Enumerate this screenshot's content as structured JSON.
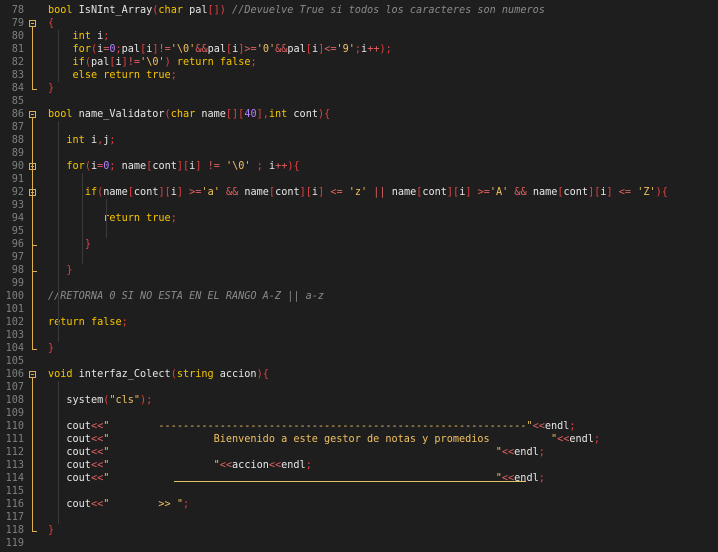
{
  "editor": {
    "accent_color": "#f6c400",
    "fold_color": "#e0b050",
    "lines": [
      {
        "n": "78",
        "tokens": [
          [
            "kw",
            "bool "
          ],
          [
            "fn",
            "IsNInt_Array"
          ],
          [
            "pn",
            "("
          ],
          [
            "ty",
            "char "
          ],
          [
            "id",
            "pal"
          ],
          [
            "pn",
            "[]"
          ],
          [
            "pn",
            ")"
          ],
          [
            "cm",
            " //Devuelve True si todos los caracteres son numeros"
          ]
        ]
      },
      {
        "n": "79",
        "tokens": [
          [
            "pn",
            "{"
          ]
        ]
      },
      {
        "n": "80",
        "tokens": [
          [
            "id",
            "    "
          ],
          [
            "kw",
            "int "
          ],
          [
            "id",
            "i"
          ],
          [
            "pn",
            ";"
          ]
        ]
      },
      {
        "n": "81",
        "tokens": [
          [
            "id",
            "    "
          ],
          [
            "kw",
            "for"
          ],
          [
            "pn",
            "("
          ],
          [
            "id",
            "i"
          ],
          [
            "op",
            "="
          ],
          [
            "num",
            "0"
          ],
          [
            "pn",
            ";"
          ],
          [
            "id",
            "pal"
          ],
          [
            "pn",
            "["
          ],
          [
            "id",
            "i"
          ],
          [
            "pn",
            "]"
          ],
          [
            "op",
            "!="
          ],
          [
            "str",
            "'\\0'"
          ],
          [
            "op",
            "&&"
          ],
          [
            "id",
            "pal"
          ],
          [
            "pn",
            "["
          ],
          [
            "id",
            "i"
          ],
          [
            "pn",
            "]"
          ],
          [
            "op",
            ">="
          ],
          [
            "str",
            "'0'"
          ],
          [
            "op",
            "&&"
          ],
          [
            "id",
            "pal"
          ],
          [
            "pn",
            "["
          ],
          [
            "id",
            "i"
          ],
          [
            "pn",
            "]"
          ],
          [
            "op",
            "<="
          ],
          [
            "str",
            "'9'"
          ],
          [
            "pn",
            ";"
          ],
          [
            "id",
            "i"
          ],
          [
            "op",
            "++"
          ],
          [
            "pn",
            ");"
          ]
        ]
      },
      {
        "n": "82",
        "tokens": [
          [
            "id",
            "    "
          ],
          [
            "kw",
            "if"
          ],
          [
            "pn",
            "("
          ],
          [
            "id",
            "pal"
          ],
          [
            "pn",
            "["
          ],
          [
            "id",
            "i"
          ],
          [
            "pn",
            "]"
          ],
          [
            "op",
            "!="
          ],
          [
            "str",
            "'\\0'"
          ],
          [
            "pn",
            ")"
          ],
          [
            "kw",
            " return "
          ],
          [
            "kw",
            "false"
          ],
          [
            "pn",
            ";"
          ]
        ]
      },
      {
        "n": "83",
        "tokens": [
          [
            "id",
            "    "
          ],
          [
            "kw",
            "else "
          ],
          [
            "kw",
            "return "
          ],
          [
            "kw",
            "true"
          ],
          [
            "pn",
            ";"
          ]
        ]
      },
      {
        "n": "84",
        "tokens": [
          [
            "pn",
            "}"
          ]
        ]
      },
      {
        "n": "85",
        "tokens": []
      },
      {
        "n": "86",
        "tokens": [
          [
            "kw",
            "bool "
          ],
          [
            "fn",
            "name_Validator"
          ],
          [
            "pn",
            "("
          ],
          [
            "ty",
            "char "
          ],
          [
            "id",
            "name"
          ],
          [
            "pn",
            "[]["
          ],
          [
            "num",
            "40"
          ],
          [
            "pn",
            "],"
          ],
          [
            "kw",
            "int "
          ],
          [
            "id",
            "cont"
          ],
          [
            "pn",
            "){"
          ]
        ]
      },
      {
        "n": "87",
        "tokens": []
      },
      {
        "n": "88",
        "tokens": [
          [
            "id",
            "   "
          ],
          [
            "kw",
            "int "
          ],
          [
            "id",
            "i"
          ],
          [
            "pn",
            ","
          ],
          [
            "id",
            "j"
          ],
          [
            "pn",
            ";"
          ]
        ]
      },
      {
        "n": "89",
        "tokens": []
      },
      {
        "n": "90",
        "tokens": [
          [
            "id",
            "   "
          ],
          [
            "kw",
            "for"
          ],
          [
            "pn",
            "("
          ],
          [
            "id",
            "i"
          ],
          [
            "op",
            "="
          ],
          [
            "num",
            "0"
          ],
          [
            "pn",
            "; "
          ],
          [
            "id",
            "name"
          ],
          [
            "pn",
            "["
          ],
          [
            "id",
            "cont"
          ],
          [
            "pn",
            "]["
          ],
          [
            "id",
            "i"
          ],
          [
            "pn",
            "]"
          ],
          [
            "op",
            " != "
          ],
          [
            "str",
            "'\\0'"
          ],
          [
            "pn",
            " ; "
          ],
          [
            "id",
            "i"
          ],
          [
            "op",
            "++"
          ],
          [
            "pn",
            "){"
          ]
        ]
      },
      {
        "n": "91",
        "tokens": []
      },
      {
        "n": "92",
        "tokens": [
          [
            "id",
            "      "
          ],
          [
            "kw",
            "if"
          ],
          [
            "pn",
            "("
          ],
          [
            "id",
            "name"
          ],
          [
            "pn",
            "["
          ],
          [
            "id",
            "cont"
          ],
          [
            "pn",
            "]["
          ],
          [
            "id",
            "i"
          ],
          [
            "pn",
            "]"
          ],
          [
            "op",
            " >="
          ],
          [
            "str",
            "'a'"
          ],
          [
            "op",
            " && "
          ],
          [
            "id",
            "name"
          ],
          [
            "pn",
            "["
          ],
          [
            "id",
            "cont"
          ],
          [
            "pn",
            "]["
          ],
          [
            "id",
            "i"
          ],
          [
            "pn",
            "]"
          ],
          [
            "op",
            " <= "
          ],
          [
            "str",
            "'z'"
          ],
          [
            "op",
            " || "
          ],
          [
            "id",
            "name"
          ],
          [
            "pn",
            "["
          ],
          [
            "id",
            "cont"
          ],
          [
            "pn",
            "]["
          ],
          [
            "id",
            "i"
          ],
          [
            "pn",
            "]"
          ],
          [
            "op",
            " >="
          ],
          [
            "str",
            "'A'"
          ],
          [
            "op",
            " && "
          ],
          [
            "id",
            "name"
          ],
          [
            "pn",
            "["
          ],
          [
            "id",
            "cont"
          ],
          [
            "pn",
            "]["
          ],
          [
            "id",
            "i"
          ],
          [
            "pn",
            "]"
          ],
          [
            "op",
            " <= "
          ],
          [
            "str",
            "'Z'"
          ],
          [
            "pn",
            "){"
          ]
        ]
      },
      {
        "n": "93",
        "tokens": []
      },
      {
        "n": "94",
        "tokens": [
          [
            "id",
            "         "
          ],
          [
            "kw",
            "return "
          ],
          [
            "kw",
            "true"
          ],
          [
            "pn",
            ";"
          ]
        ]
      },
      {
        "n": "95",
        "tokens": []
      },
      {
        "n": "96",
        "tokens": [
          [
            "id",
            "      "
          ],
          [
            "pn",
            "}"
          ]
        ]
      },
      {
        "n": "97",
        "tokens": []
      },
      {
        "n": "98",
        "tokens": [
          [
            "id",
            "   "
          ],
          [
            "pn",
            "}"
          ]
        ]
      },
      {
        "n": "99",
        "tokens": []
      },
      {
        "n": "100",
        "tokens": [
          [
            "cm",
            "//RETORNA 0 SI NO ESTA EN EL RANGO A-Z || a-z"
          ]
        ]
      },
      {
        "n": "101",
        "tokens": []
      },
      {
        "n": "102",
        "tokens": [
          [
            "kw",
            "return "
          ],
          [
            "kw",
            "false"
          ],
          [
            "pn",
            ";"
          ]
        ]
      },
      {
        "n": "103",
        "tokens": []
      },
      {
        "n": "104",
        "tokens": [
          [
            "pn",
            "}"
          ]
        ]
      },
      {
        "n": "105",
        "tokens": []
      },
      {
        "n": "106",
        "tokens": [
          [
            "kw",
            "void "
          ],
          [
            "fn",
            "interfaz_Colect"
          ],
          [
            "pn",
            "("
          ],
          [
            "ty",
            "string "
          ],
          [
            "id",
            "accion"
          ],
          [
            "pn",
            "){"
          ]
        ]
      },
      {
        "n": "107",
        "tokens": []
      },
      {
        "n": "108",
        "tokens": [
          [
            "id",
            "   "
          ],
          [
            "fn",
            "system"
          ],
          [
            "pn",
            "("
          ],
          [
            "str",
            "\"cls\""
          ],
          [
            "pn",
            ");"
          ]
        ]
      },
      {
        "n": "109",
        "tokens": []
      },
      {
        "n": "110",
        "tokens": [
          [
            "id",
            "   cout"
          ],
          [
            "op",
            "<<"
          ],
          [
            "str",
            "\"        ------------------------------------------------------------\""
          ],
          [
            "op",
            "<<"
          ],
          [
            "id",
            "endl"
          ],
          [
            "pn",
            ";"
          ]
        ]
      },
      {
        "n": "111",
        "tokens": [
          [
            "id",
            "   cout"
          ],
          [
            "op",
            "<<"
          ],
          [
            "str",
            "\"                 Bienvenido a este gestor de notas y promedios          \""
          ],
          [
            "op",
            "<<"
          ],
          [
            "id",
            "endl"
          ],
          [
            "pn",
            ";"
          ]
        ]
      },
      {
        "n": "112",
        "tokens": [
          [
            "id",
            "   cout"
          ],
          [
            "op",
            "<<"
          ],
          [
            "str",
            "\"                                                               \""
          ],
          [
            "op",
            "<<"
          ],
          [
            "id",
            "endl"
          ],
          [
            "pn",
            ";"
          ]
        ]
      },
      {
        "n": "113",
        "tokens": [
          [
            "id",
            "   cout"
          ],
          [
            "op",
            "<<"
          ],
          [
            "str",
            "\"                 \""
          ],
          [
            "op",
            "<<"
          ],
          [
            "id",
            "accion"
          ],
          [
            "op",
            "<<"
          ],
          [
            "id",
            "endl"
          ],
          [
            "pn",
            ";"
          ]
        ]
      },
      {
        "n": "114",
        "tokens": [
          [
            "id",
            "   cout"
          ],
          [
            "op",
            "<<"
          ],
          [
            "str",
            "\"                                                               \""
          ],
          [
            "op",
            "<<"
          ],
          [
            "id",
            "endl"
          ],
          [
            "pn",
            ";"
          ]
        ]
      },
      {
        "n": "115",
        "tokens": []
      },
      {
        "n": "116",
        "tokens": [
          [
            "id",
            "   cout"
          ],
          [
            "op",
            "<<"
          ],
          [
            "str",
            "\"        >> \""
          ],
          [
            "pn",
            ";"
          ]
        ]
      },
      {
        "n": "117",
        "tokens": []
      },
      {
        "n": "118",
        "tokens": [
          [
            "pn",
            "}"
          ]
        ]
      },
      {
        "n": "119",
        "tokens": []
      }
    ]
  }
}
